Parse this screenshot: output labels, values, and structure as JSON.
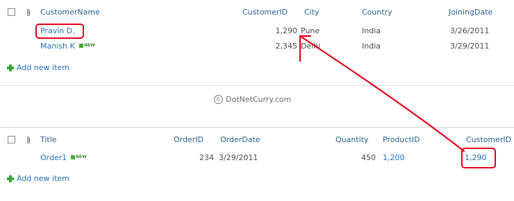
{
  "customers_list": {
    "headers": {
      "name": "CustomerName",
      "id": "CustomerID",
      "city": "City",
      "country": "Country",
      "joining": "JoiningDate"
    },
    "rows": [
      {
        "name": "Pravin D.",
        "id": "1,290",
        "city": "Pune",
        "country": "India",
        "joining": "3/26/2011",
        "is_new": false
      },
      {
        "name": "Manish K",
        "id": "2,345",
        "city": "Delhi",
        "country": "India",
        "joining": "3/29/2011",
        "is_new": true
      }
    ],
    "add_new": "Add new item"
  },
  "watermark": {
    "text": "DotNetCurry.com",
    "symbol": "©"
  },
  "orders_list": {
    "headers": {
      "title": "Title",
      "order_id": "OrderID",
      "order_date": "OrderDate",
      "quantity": "Quantity",
      "product_id": "ProductID",
      "customer_id": "CustomerID"
    },
    "rows": [
      {
        "title": "Order1",
        "order_id": "234",
        "order_date": "3/29/2011",
        "quantity": "450",
        "product_id": "1,200",
        "customer_id": "1,290",
        "is_new": true
      }
    ],
    "add_new": "Add new item"
  },
  "new_badge": "NEW",
  "colors": {
    "accent_link": "#1f6fb5",
    "header_text": "#2a6190",
    "annotation_red": "#e0001a",
    "add_icon_green": "#3aa43a"
  },
  "icons": [
    "checkbox-icon",
    "attachment-icon",
    "new-badge-icon",
    "add-icon",
    "copyright-icon"
  ]
}
